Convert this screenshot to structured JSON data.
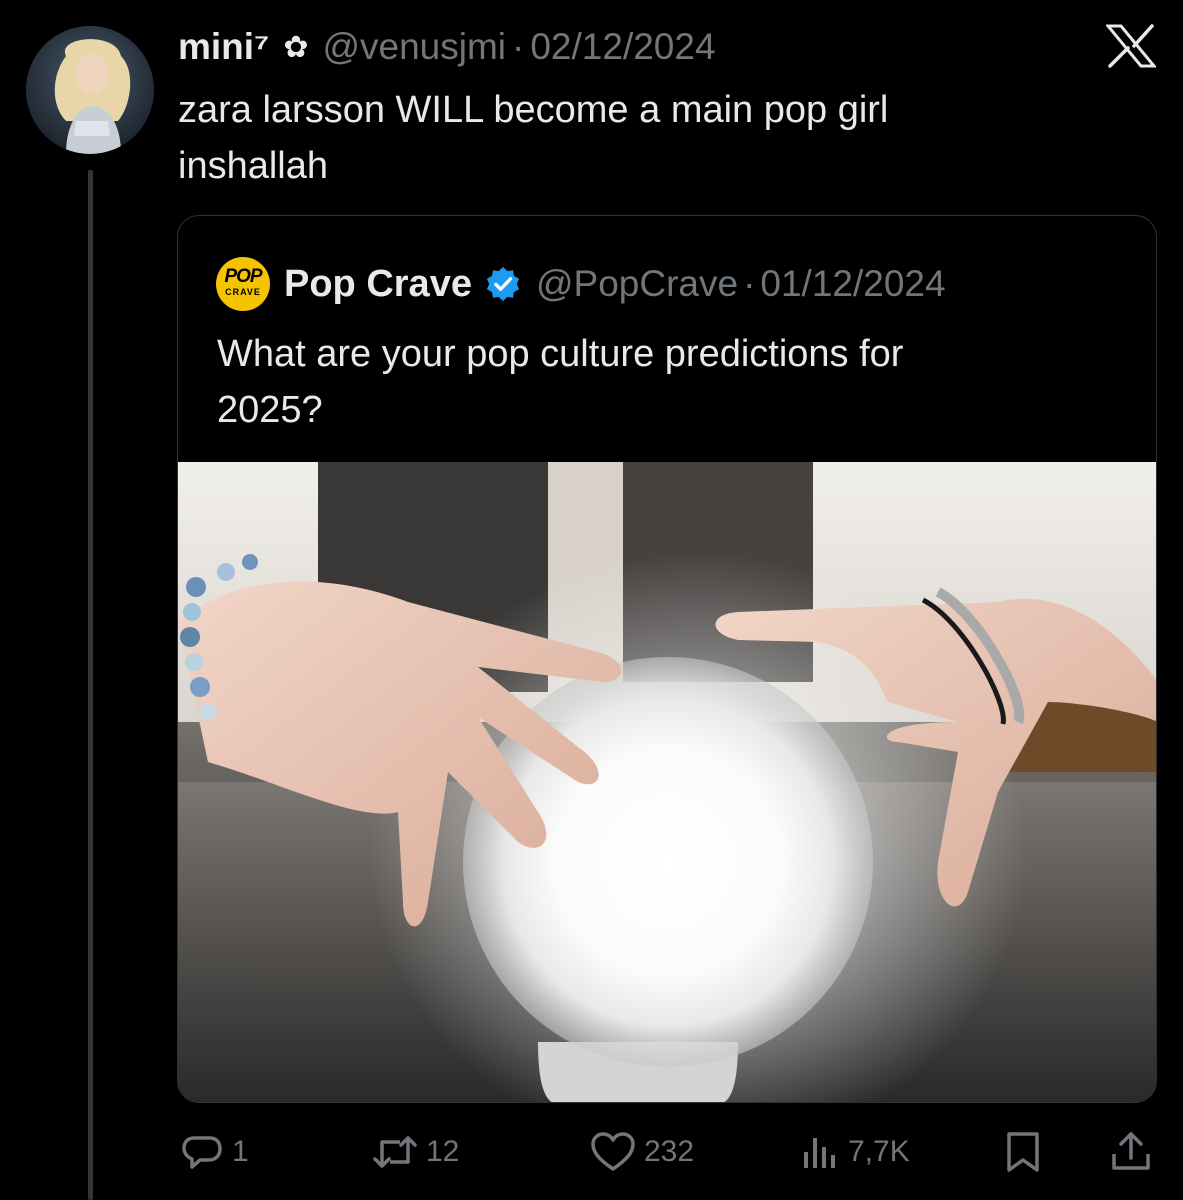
{
  "tweet": {
    "display_name": "mini⁷",
    "badge_glyph": "✿",
    "handle": "@venusjmi",
    "separator": "·",
    "date": "02/12/2024",
    "text_line1": "zara larsson WILL become a main pop girl",
    "text_line2": "inshallah"
  },
  "quoted": {
    "logo_top": "POP",
    "logo_bottom": "CRAVE",
    "display_name": "Pop Crave",
    "handle": "@PopCrave",
    "separator": "·",
    "date": "01/12/2024",
    "text_line1": "What are your pop culture predictions for",
    "text_line2": "2025?"
  },
  "actions": {
    "replies": "1",
    "reposts": "12",
    "likes": "232",
    "views": "7,7K"
  },
  "icons": [
    "x-logo-icon",
    "verified-badge-icon",
    "reply-icon",
    "repost-icon",
    "like-icon",
    "views-icon",
    "bookmark-icon",
    "share-icon"
  ],
  "colors": {
    "background": "#000000",
    "text_primary": "#e7e9ea",
    "text_secondary": "#71767b",
    "verified": "#1d9bf0",
    "popcrave_yellow": "#f5c400"
  }
}
